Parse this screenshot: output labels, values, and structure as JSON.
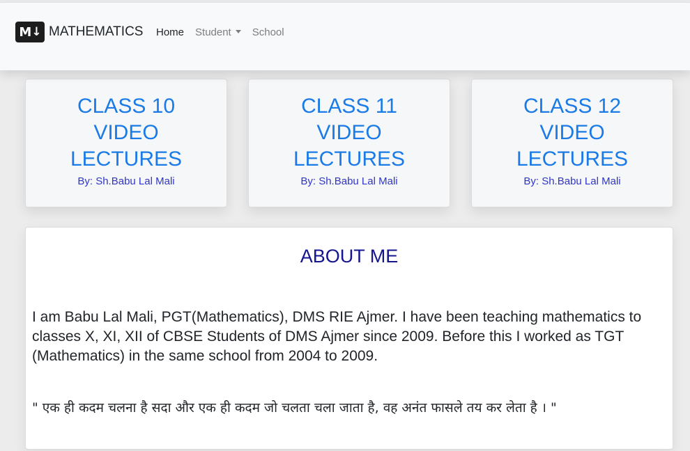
{
  "nav": {
    "brand_logo": "M↓",
    "brand_text": "MATHEMATICS",
    "links": [
      {
        "label": "Home",
        "active": true
      },
      {
        "label": "Student",
        "dropdown": true
      },
      {
        "label": "School"
      }
    ]
  },
  "cards": [
    {
      "title": "CLASS 10 VIDEO LECTURES",
      "byline": "By: Sh.Babu Lal Mali"
    },
    {
      "title": "CLASS 11 VIDEO LECTURES",
      "byline": "By: Sh.Babu Lal Mali"
    },
    {
      "title": "CLASS 12 VIDEO LECTURES",
      "byline": "By: Sh.Babu Lal Mali"
    }
  ],
  "about": {
    "heading": "ABOUT ME",
    "bio": "I am Babu Lal Mali, PGT(Mathematics), DMS RIE Ajmer. I have been teaching mathematics to classes X, XI, XII of CBSE Students of DMS Ajmer since 2009. Before this I worked as TGT (Mathematics) in the same school from 2004 to 2009.",
    "quote": "\" एक ही कदम चलना है सदा और एक ही कदम जो चलता चला जाता है, वह अनंत फासले तय कर लेता है । \""
  },
  "colors": {
    "card_title": "#1a7be6",
    "card_byline": "#2f35c8",
    "about_heading": "#15158f"
  }
}
